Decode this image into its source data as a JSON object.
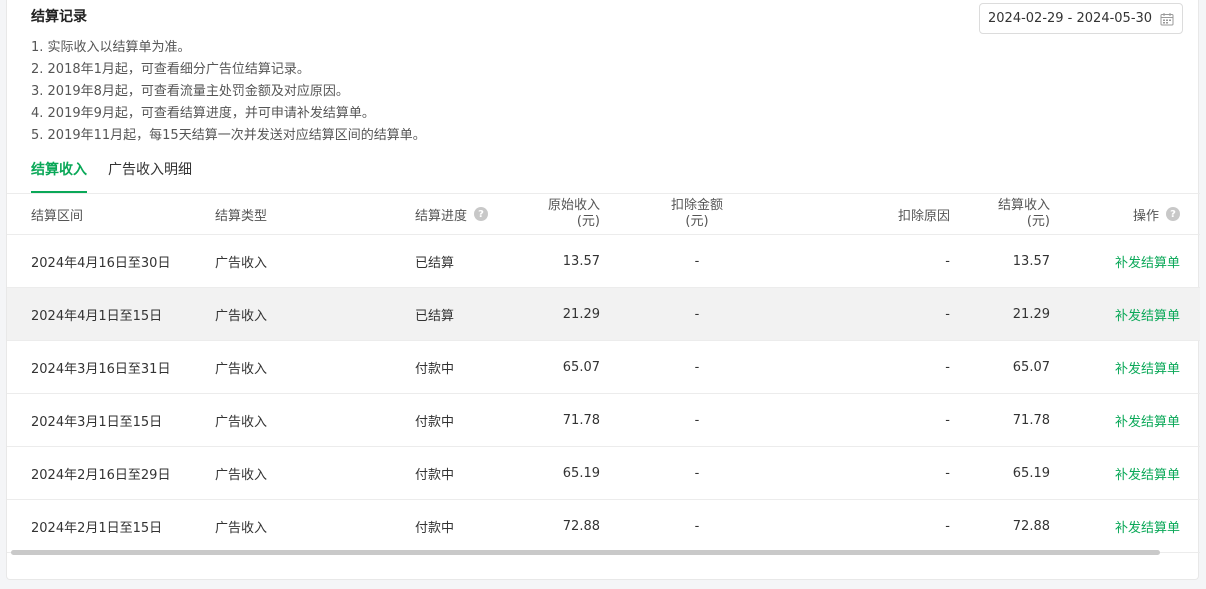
{
  "page": {
    "title": "结算记录",
    "date_range": "2024-02-29 - 2024-05-30",
    "notes": [
      "1. 实际收入以结算单为准。",
      "2. 2018年1月起，可查看细分广告位结算记录。",
      "3. 2019年8月起，可查看流量主处罚金额及对应原因。",
      "4. 2019年9月起，可查看结算进度，并可申请补发结算单。",
      "5. 2019年11月起，每15天结算一次并发送对应结算区间的结算单。"
    ],
    "tabs": [
      {
        "label": "结算收入",
        "active": true
      },
      {
        "label": "广告收入明细",
        "active": false
      }
    ],
    "accent_color": "#0aa858"
  },
  "table": {
    "headers": {
      "range": "结算区间",
      "type": "结算类型",
      "progress": "结算进度",
      "orig_line1": "原始收入",
      "orig_line2": "(元)",
      "deduct_line1": "扣除金额",
      "deduct_line2": "(元)",
      "reason": "扣除原因",
      "settle_line1": "结算收入",
      "settle_line2": "(元)",
      "op": "操作"
    },
    "rows": [
      {
        "range": "2024年4月16日至30日",
        "type": "广告收入",
        "progress": "已结算",
        "orig": "13.57",
        "deduct": "-",
        "reason": "-",
        "settle": "13.57",
        "op": "补发结算单"
      },
      {
        "range": "2024年4月1日至15日",
        "type": "广告收入",
        "progress": "已结算",
        "orig": "21.29",
        "deduct": "-",
        "reason": "-",
        "settle": "21.29",
        "op": "补发结算单"
      },
      {
        "range": "2024年3月16日至31日",
        "type": "广告收入",
        "progress": "付款中",
        "orig": "65.07",
        "deduct": "-",
        "reason": "-",
        "settle": "65.07",
        "op": "补发结算单"
      },
      {
        "range": "2024年3月1日至15日",
        "type": "广告收入",
        "progress": "付款中",
        "orig": "71.78",
        "deduct": "-",
        "reason": "-",
        "settle": "71.78",
        "op": "补发结算单"
      },
      {
        "range": "2024年2月16日至29日",
        "type": "广告收入",
        "progress": "付款中",
        "orig": "65.19",
        "deduct": "-",
        "reason": "-",
        "settle": "65.19",
        "op": "补发结算单"
      },
      {
        "range": "2024年2月1日至15日",
        "type": "广告收入",
        "progress": "付款中",
        "orig": "72.88",
        "deduct": "-",
        "reason": "-",
        "settle": "72.88",
        "op": "补发结算单"
      }
    ]
  },
  "icons": {
    "calendar": "calendar-icon",
    "help": "question-mark-icon",
    "help_glyph": "?"
  }
}
